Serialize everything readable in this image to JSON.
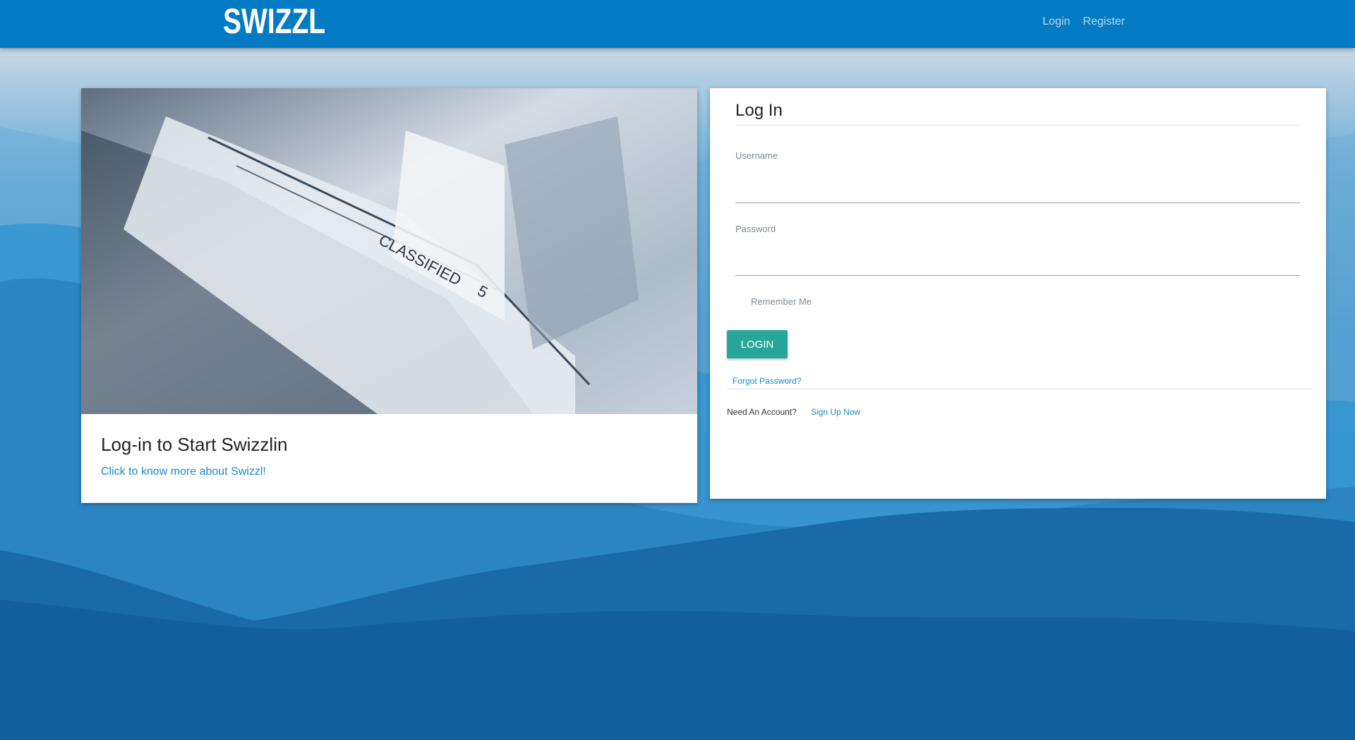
{
  "navbar": {
    "brand": "SWIZZL",
    "links": [
      "Login",
      "Register"
    ]
  },
  "info_card": {
    "title": "Log-in to Start Swizzlin",
    "link": "Click to know more about Swizzl!"
  },
  "login_card": {
    "title": "Log In",
    "username_label": "Username",
    "password_label": "Password",
    "remember_label": "Remember Me",
    "login_button": "LOGIN",
    "forgot_link": "Forgot Password?",
    "need_account_text": "Need An Account?",
    "signup_link": "Sign Up Now"
  },
  "colors": {
    "navbar": "#027bc4",
    "button": "#26a69a",
    "link": "#1a8cc9"
  }
}
